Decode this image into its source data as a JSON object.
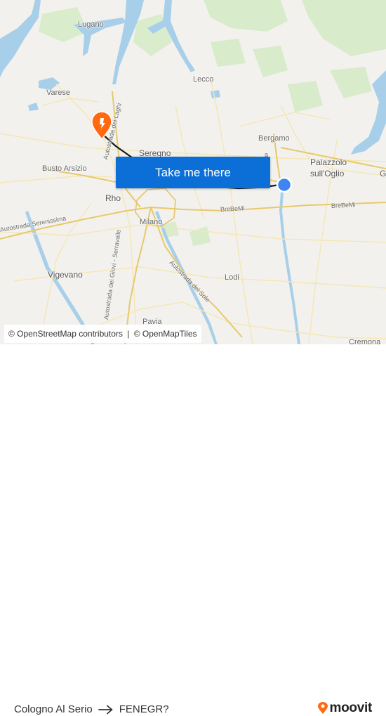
{
  "map": {
    "places": [
      {
        "id": "lugano",
        "name": "Lugano"
      },
      {
        "id": "varese",
        "name": "Varese"
      },
      {
        "id": "lecco",
        "name": "Lecco"
      },
      {
        "id": "bergamo",
        "name": "Bergamo"
      },
      {
        "id": "palazzolo",
        "name": "Palazzolo\nsull'Oglio"
      },
      {
        "id": "seregno",
        "name": "Seregno"
      },
      {
        "id": "busto",
        "name": "Busto Arsizio"
      },
      {
        "id": "rho",
        "name": "Rho"
      },
      {
        "id": "milano",
        "name": "Milano"
      },
      {
        "id": "vigevano",
        "name": "Vigevano"
      },
      {
        "id": "lodi",
        "name": "Lodi"
      },
      {
        "id": "pavia",
        "name": "Pavia"
      },
      {
        "id": "cremona",
        "name": "Cremona"
      },
      {
        "id": "edge_g",
        "name": "G"
      }
    ],
    "road_labels": [
      {
        "id": "laghi",
        "name": "Autostrada dei Laghi"
      },
      {
        "id": "serenissima",
        "name": "Autostrada Serenissima"
      },
      {
        "id": "brebemi1",
        "name": "BreBeMi"
      },
      {
        "id": "brebemi2",
        "name": "BreBeMi"
      },
      {
        "id": "giovi",
        "name": "Autostrada dei Giovi - Serravalle"
      },
      {
        "id": "sole",
        "name": "Autostrada del Sole"
      },
      {
        "id": "partial_a",
        "name": "a"
      }
    ],
    "origin_marker": "origin-dot",
    "destination_marker": "destination-pin",
    "colors": {
      "water": "#a8cfe9",
      "land": "#f2f1ee",
      "forest": "#cfe8c0",
      "route": "#1a1a1a",
      "origin": "#3d85f0",
      "destination": "#ff6a10"
    }
  },
  "cta": {
    "label": "Take me there"
  },
  "attribution": {
    "part1": "© OpenStreetMap contributors",
    "separator": "|",
    "part2": "© OpenMapTiles"
  },
  "footer": {
    "from": "Cologno Al Serio",
    "to": "FENEGR?",
    "arrow_icon": "arrow-right-icon",
    "brand": "moovit",
    "brand_color": "#ff6a10"
  }
}
